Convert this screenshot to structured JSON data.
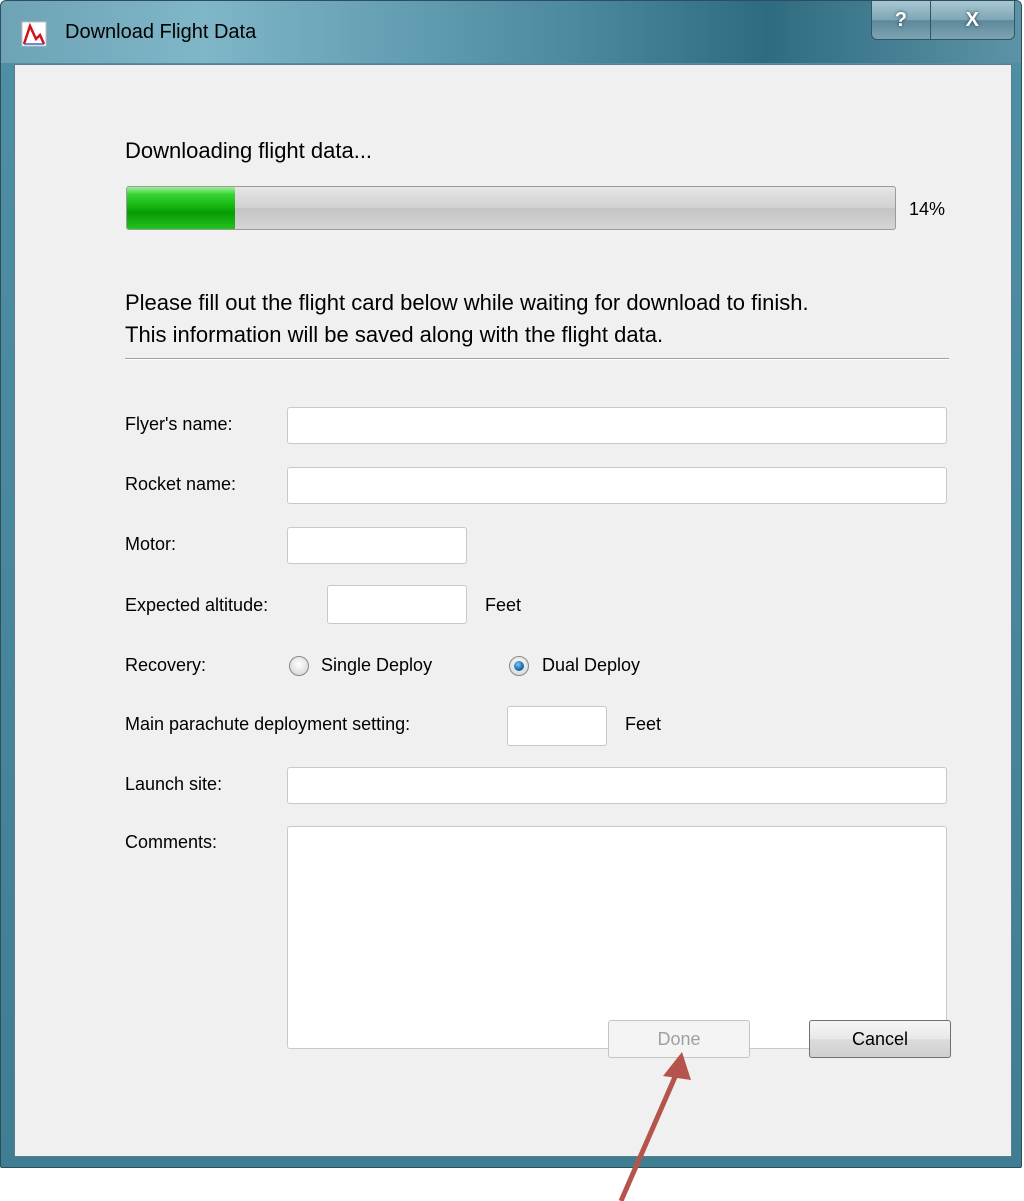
{
  "window": {
    "title": "Download Flight Data",
    "help_label": "?",
    "close_label": "X"
  },
  "progress": {
    "label": "Downloading flight data...",
    "value": 0.14,
    "percent_text": "14%",
    "fill_color": "#10b00c"
  },
  "instructions": {
    "line1": "Please fill out the flight card below while waiting for download to finish.",
    "line2": "This information will be saved along with the flight data."
  },
  "form": {
    "flyers_name_label": "Flyer's name:",
    "flyers_name_value": "",
    "rocket_name_label": "Rocket name:",
    "rocket_name_value": "",
    "motor_label": "Motor:",
    "motor_value": "",
    "expected_altitude_label": "Expected altitude:",
    "expected_altitude_value": "",
    "expected_altitude_unit": "Feet",
    "recovery_label": "Recovery:",
    "recovery_options": [
      "Single Deploy",
      "Dual Deploy"
    ],
    "recovery_selected": "Dual Deploy",
    "main_chute_label": "Main parachute deployment setting:",
    "main_chute_value": "",
    "main_chute_unit": "Feet",
    "launch_site_label": "Launch site:",
    "launch_site_value": "",
    "comments_label": "Comments:",
    "comments_value": ""
  },
  "buttons": {
    "done_label": "Done",
    "done_enabled": false,
    "cancel_label": "Cancel"
  },
  "annotation": {
    "arrow_color": "#b5544d"
  }
}
